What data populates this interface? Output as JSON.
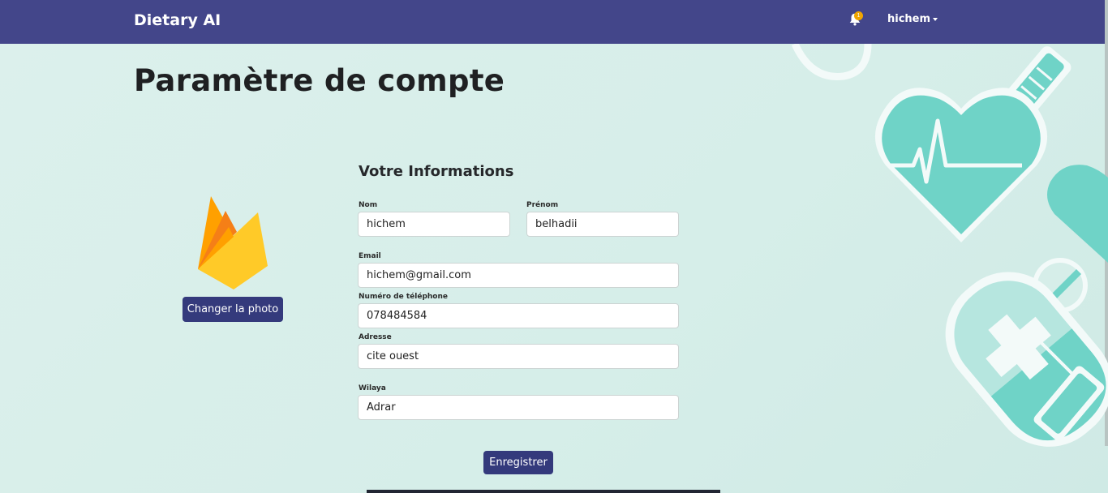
{
  "navbar": {
    "brand": "Dietary AI",
    "notification_count": "1",
    "user_name": "hichem"
  },
  "page": {
    "title": "Paramètre de compte"
  },
  "profile": {
    "change_photo_label": "Changer la photo"
  },
  "form": {
    "section_title": "Votre Informations",
    "fields": {
      "nom": {
        "label": "Nom",
        "value": "hichem"
      },
      "prenom": {
        "label": "Prénom",
        "value": "belhadii"
      },
      "email": {
        "label": "Email",
        "value": "hichem@gmail.com"
      },
      "telephone": {
        "label": "Numéro de téléphone",
        "value": "078484584"
      },
      "adresse": {
        "label": "Adresse",
        "value": "cite ouest"
      },
      "wilaya": {
        "label": "Wilaya",
        "value": "Adrar"
      }
    },
    "save_label": "Enregistrer"
  },
  "colors": {
    "navbar": "#43468a",
    "button": "#343a7c",
    "accent_teal": "#6fd3c7",
    "badge": "#f0a500"
  },
  "icons": {
    "notification": "bell-icon",
    "logo": "firebase-flame-logo",
    "user_caret": "caret-down-icon"
  }
}
